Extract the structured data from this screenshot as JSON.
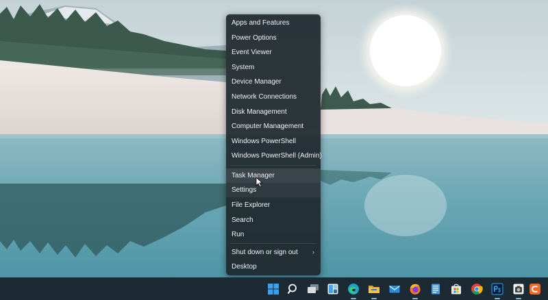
{
  "context_menu": {
    "items": [
      {
        "label": "Apps and Features"
      },
      {
        "label": "Power Options"
      },
      {
        "label": "Event Viewer"
      },
      {
        "label": "System"
      },
      {
        "label": "Device Manager"
      },
      {
        "label": "Network Connections"
      },
      {
        "label": "Disk Management"
      },
      {
        "label": "Computer Management"
      },
      {
        "label": "Windows PowerShell"
      },
      {
        "label": "Windows PowerShell (Admin)"
      },
      {
        "label": "Task Manager"
      },
      {
        "label": "Settings"
      },
      {
        "label": "File Explorer"
      },
      {
        "label": "Search"
      },
      {
        "label": "Run"
      },
      {
        "label": "Shut down or sign out"
      },
      {
        "label": "Desktop"
      }
    ],
    "hovered_item": "Task Manager",
    "submenu_arrow": "›"
  },
  "taskbar": {
    "icons": [
      {
        "name": "start-icon",
        "color": "#3aa0f0"
      },
      {
        "name": "search-icon",
        "color": "#ffffff"
      },
      {
        "name": "task-view-icon",
        "color": "#d9dde0"
      },
      {
        "name": "widgets-icon",
        "color": "#4aa3e8"
      },
      {
        "name": "edge-icon",
        "color": "#1fa2c9"
      },
      {
        "name": "file-explorer-icon",
        "color": "#f2c14e"
      },
      {
        "name": "mail-icon",
        "color": "#2b8ae0"
      },
      {
        "name": "firefox-icon",
        "color": "#ff7a1a"
      },
      {
        "name": "notepad-icon",
        "color": "#4a9de0"
      },
      {
        "name": "store-icon",
        "color": "#e8e8e8"
      },
      {
        "name": "chrome-icon",
        "color": "#db4437"
      },
      {
        "name": "photoshop-icon",
        "color": "#31a8ff"
      },
      {
        "name": "camera-app-icon",
        "color": "#f2f2f2"
      },
      {
        "name": "orange-app-icon",
        "color": "#f26a2a"
      }
    ]
  }
}
